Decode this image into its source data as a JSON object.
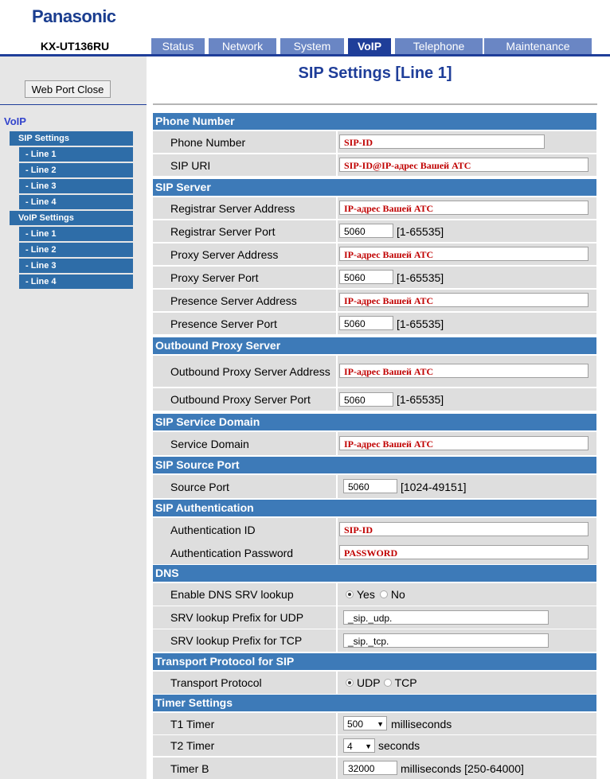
{
  "header": {
    "logo": "Panasonic",
    "model": "KX-UT136RU",
    "tabs": [
      {
        "label": "Status",
        "active": false
      },
      {
        "label": "Network",
        "active": false
      },
      {
        "label": "System",
        "active": false
      },
      {
        "label": "VoIP",
        "active": true
      },
      {
        "label": "Telephone",
        "active": false
      },
      {
        "label": "Maintenance",
        "active": false
      }
    ]
  },
  "sidebar": {
    "close_button": "Web Port Close",
    "section_label": "VoIP",
    "items": [
      {
        "label": "SIP Settings",
        "level": "main"
      },
      {
        "label": "- Line 1",
        "level": "sub"
      },
      {
        "label": "- Line 2",
        "level": "sub"
      },
      {
        "label": "- Line 3",
        "level": "sub"
      },
      {
        "label": "- Line 4",
        "level": "sub"
      },
      {
        "label": "VoIP Settings",
        "level": "main"
      },
      {
        "label": "- Line 1",
        "level": "sub"
      },
      {
        "label": "- Line 2",
        "level": "sub"
      },
      {
        "label": "- Line 3",
        "level": "sub"
      },
      {
        "label": "- Line 4",
        "level": "sub"
      }
    ]
  },
  "main": {
    "title": "SIP Settings [Line 1]",
    "sections": {
      "phone_number": "Phone Number",
      "sip_server": "SIP Server",
      "outbound_proxy": "Outbound Proxy Server",
      "service_domain": "SIP Service Domain",
      "source_port": "SIP Source Port",
      "authentication": "SIP Authentication",
      "dns": "DNS",
      "transport": "Transport Protocol for SIP",
      "timer": "Timer Settings"
    },
    "fields": {
      "phone_number": {
        "label": "Phone Number",
        "value": "SIP-ID"
      },
      "sip_uri": {
        "label": "SIP URI",
        "value": "SIP-ID@IP-адрес Вашей АТС"
      },
      "registrar_address": {
        "label": "Registrar Server Address",
        "value": "IP-адрес Вашей АТС"
      },
      "registrar_port": {
        "label": "Registrar Server Port",
        "value": "5060",
        "range": "[1-65535]"
      },
      "proxy_address": {
        "label": "Proxy Server Address",
        "value": "IP-адрес Вашей АТС"
      },
      "proxy_port": {
        "label": "Proxy Server Port",
        "value": "5060",
        "range": "[1-65535]"
      },
      "presence_address": {
        "label": "Presence Server Address",
        "value": "IP-адрес Вашей АТС"
      },
      "presence_port": {
        "label": "Presence Server Port",
        "value": "5060",
        "range": "[1-65535]"
      },
      "outbound_address": {
        "label": "Outbound Proxy Server Address",
        "value": "IP-адрес Вашей АТС"
      },
      "outbound_port": {
        "label": "Outbound Proxy Server Port",
        "value": "5060",
        "range": "[1-65535]"
      },
      "service_domain": {
        "label": "Service Domain",
        "value": "IP-адрес Вашей АТС"
      },
      "source_port": {
        "label": "Source Port",
        "value": "5060",
        "range": "[1024-49151]"
      },
      "auth_id": {
        "label": "Authentication ID",
        "value": "SIP-ID"
      },
      "auth_password": {
        "label": "Authentication Password",
        "value": "PASSWORD"
      },
      "dns_srv": {
        "label": "Enable DNS SRV lookup",
        "yes": "Yes",
        "no": "No",
        "selected": "Yes"
      },
      "srv_udp": {
        "label": "SRV lookup Prefix for UDP",
        "value": "_sip._udp."
      },
      "srv_tcp": {
        "label": "SRV lookup Prefix for TCP",
        "value": "_sip._tcp."
      },
      "transport": {
        "label": "Transport Protocol",
        "udp": "UDP",
        "tcp": "TCP",
        "selected": "UDP"
      },
      "t1": {
        "label": "T1 Timer",
        "value": "500",
        "unit": "milliseconds"
      },
      "t2": {
        "label": "T2 Timer",
        "value": "4",
        "unit": "seconds"
      },
      "timer_b": {
        "label": "Timer B",
        "value": "32000",
        "unit": "milliseconds [250-64000]"
      }
    }
  }
}
